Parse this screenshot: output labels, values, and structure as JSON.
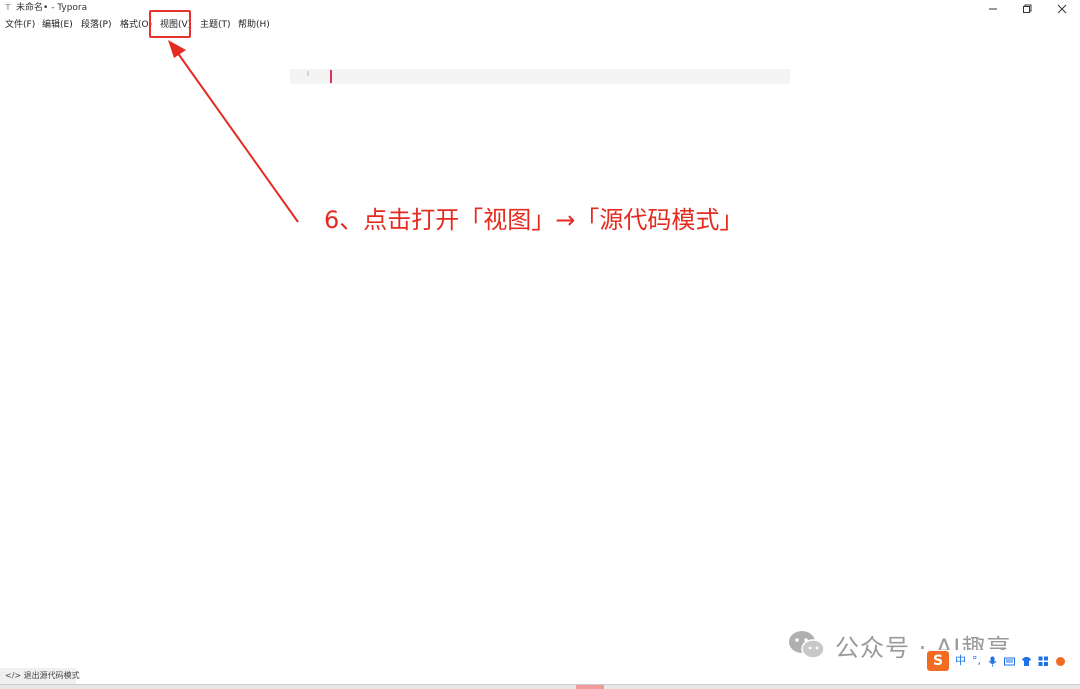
{
  "window": {
    "app_icon": "T",
    "title": "未命名• - Typora"
  },
  "menubar": {
    "items": [
      {
        "id": "file",
        "label": "文件(F)"
      },
      {
        "id": "edit",
        "label": "编辑(E)"
      },
      {
        "id": "paragraph",
        "label": "段落(P)"
      },
      {
        "id": "format",
        "label": "格式(O)"
      },
      {
        "id": "view",
        "label": "视图(V)"
      },
      {
        "id": "theme",
        "label": "主题(T)"
      },
      {
        "id": "help",
        "label": "帮助(H)"
      }
    ]
  },
  "editor": {
    "gutter_mark": "I"
  },
  "annotation": {
    "text": "6、点击打开「视图」→「源代码模式」",
    "color": "#e42b20"
  },
  "watermark": {
    "text": "公众号 · AI趣享"
  },
  "ime": {
    "logo": "S",
    "mode": "中",
    "punct": "°,"
  },
  "statusbar": {
    "source_mode_toggle": "</> 退出源代码模式"
  }
}
